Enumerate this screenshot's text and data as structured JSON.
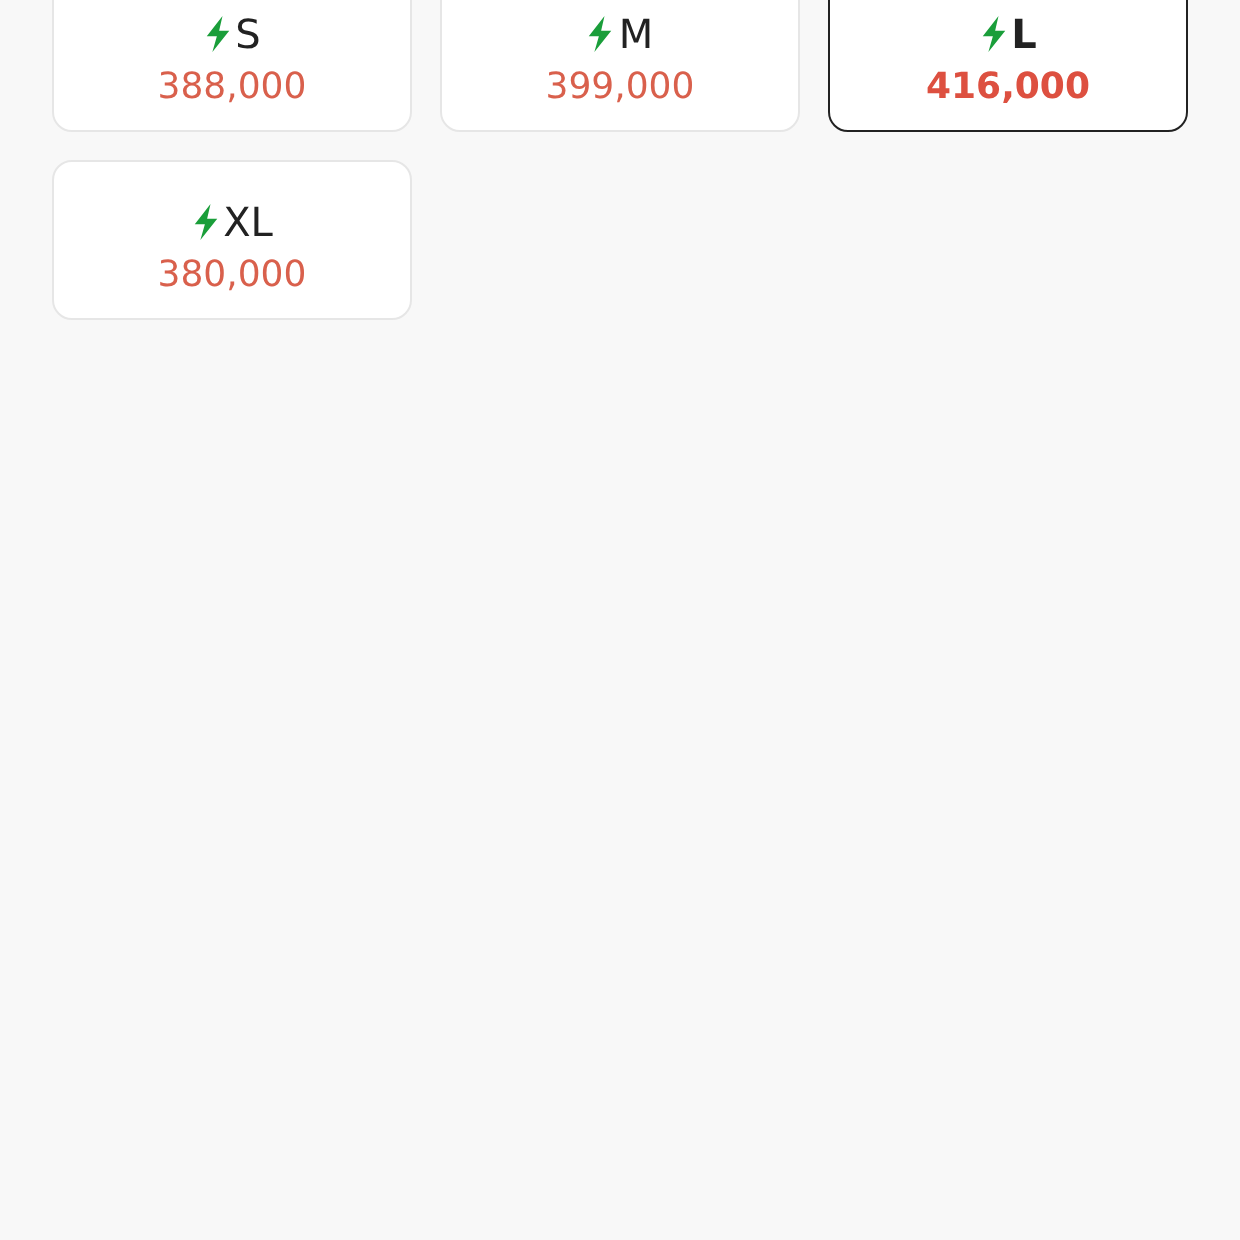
{
  "sizes": [
    {
      "label": "S",
      "price": "388,000",
      "selected": false
    },
    {
      "label": "M",
      "price": "399,000",
      "selected": false
    },
    {
      "label": "L",
      "price": "416,000",
      "selected": true
    },
    {
      "label": "XL",
      "price": "380,000",
      "selected": false
    }
  ]
}
